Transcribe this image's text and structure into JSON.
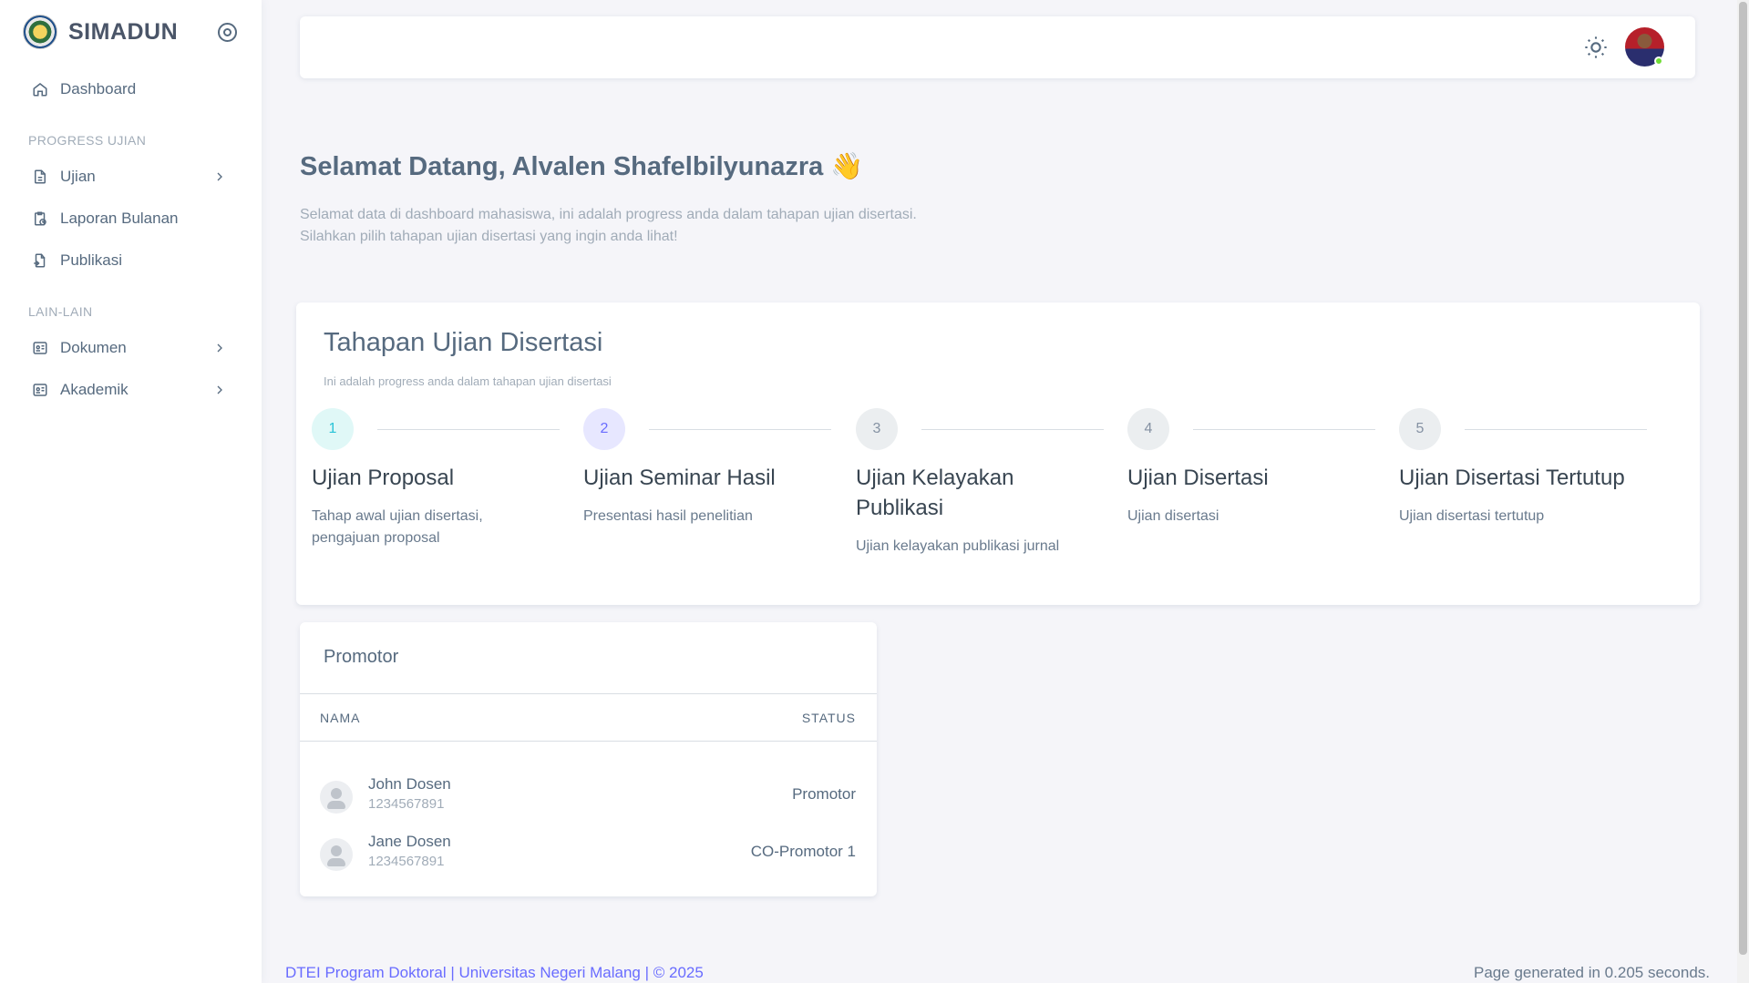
{
  "app": {
    "brand": "SIMADUN"
  },
  "sidebar": {
    "items": [
      {
        "label": "Dashboard",
        "icon": "home-icon"
      },
      {
        "label": "Ujian",
        "icon": "file-icon",
        "has_children": true
      },
      {
        "label": "Laporan Bulanan",
        "icon": "clipboard-clock-icon"
      },
      {
        "label": "Publikasi",
        "icon": "file-upload-icon"
      },
      {
        "label": "Dokumen",
        "icon": "id-card-icon",
        "has_children": true
      },
      {
        "label": "Akademik",
        "icon": "id-card-icon",
        "has_children": true
      }
    ],
    "sections": [
      "PROGRESS UJIAN",
      "LAIN-LAIN"
    ]
  },
  "welcome": {
    "title": "Selamat Datang, Alvalen Shafelbilyunazra 👋",
    "line1": "Selamat data di dashboard mahasiswa, ini adalah progress anda dalam tahapan ujian disertasi.",
    "line2": "Silahkan pilih tahapan ujian disertasi yang ingin anda lihat!"
  },
  "steps_card": {
    "title": "Tahapan Ujian Disertasi",
    "subtitle": "Ini adalah progress anda dalam tahapan ujian disertasi",
    "steps": [
      {
        "number": "1",
        "title": "Ujian Proposal",
        "desc": "Tahap awal ujian disertasi, pengajuan proposal",
        "color": "#28c3d7",
        "bg": "#e0f8f7"
      },
      {
        "number": "2",
        "title": "Ujian Seminar Hasil",
        "desc": "Presentasi hasil penelitian",
        "color": "#696cff",
        "bg": "#e7e7ff"
      },
      {
        "number": "3",
        "title": "Ujian Kelayakan Publikasi",
        "desc": "Ujian kelayakan publikasi jurnal",
        "color": "#8592a3",
        "bg": "#ebeef0"
      },
      {
        "number": "4",
        "title": "Ujian Disertasi",
        "desc": "Ujian disertasi",
        "color": "#8592a3",
        "bg": "#ebeef0"
      },
      {
        "number": "5",
        "title": "Ujian Disertasi Tertutup",
        "desc": "Ujian disertasi tertutup",
        "color": "#8592a3",
        "bg": "#ebeef0"
      }
    ]
  },
  "promotor": {
    "title": "Promotor",
    "columns": [
      "NAMA",
      "STATUS"
    ],
    "rows": [
      {
        "name": "John Dosen",
        "id": "1234567891",
        "status": "Promotor"
      },
      {
        "name": "Jane Dosen",
        "id": "1234567891",
        "status": "CO-Promotor 1"
      }
    ]
  },
  "footer": {
    "left": "DTEI Program Doktoral | Universitas Negeri Malang | © 2025",
    "right": "Page generated in 0.205 seconds."
  },
  "colors": {
    "primary": "#696cff",
    "online": "#71dd37",
    "text": "#566a7f"
  }
}
